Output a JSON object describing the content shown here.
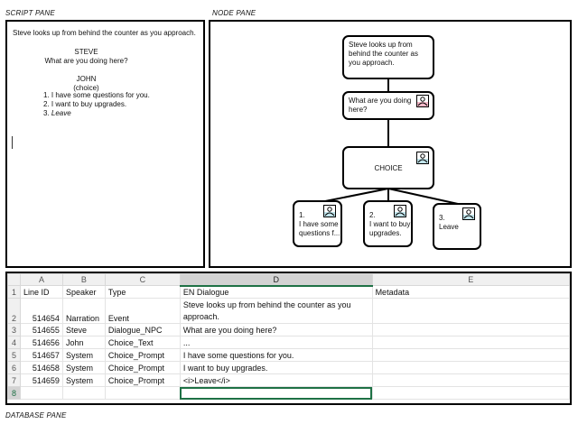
{
  "labels": {
    "script_pane": "SCRIPT PANE",
    "node_pane": "NODE PANE",
    "database_pane": "DATABASE PANE"
  },
  "script": {
    "narration": "Steve looks up from behind the counter as you approach.",
    "speaker1": "STEVE",
    "line1": "What are you doing here?",
    "speaker2": "JOHN",
    "parenthetical": "(choice)",
    "options": [
      "1. I have some questions for you.",
      "2. I want to buy upgrades.",
      "3. "
    ],
    "option3_italic": "Leave"
  },
  "nodes": {
    "event": {
      "text_lines": [
        "Steve looks up from",
        "behind the counter as",
        "you approach."
      ]
    },
    "dialogue": {
      "text_lines": [
        "What are you doing",
        "here?"
      ],
      "icon": "portrait-icon",
      "icon_color": "#f5b8c8"
    },
    "choice": {
      "text": "CHOICE",
      "icon": "portrait-icon",
      "icon_color": "#bfe3ea"
    },
    "options": [
      {
        "text_lines": [
          "1.",
          "I have some",
          "questions f..."
        ],
        "icon": "portrait-icon",
        "icon_color": "#bfe3ea"
      },
      {
        "text_lines": [
          "2.",
          "I want to buy",
          "upgrades."
        ],
        "icon": "portrait-icon",
        "icon_color": "#bfe3ea"
      },
      {
        "text_lines": [
          "3.",
          "Leave"
        ],
        "icon": "portrait-icon",
        "icon_color": "#bfe3ea"
      }
    ]
  },
  "database": {
    "column_letters": [
      "A",
      "B",
      "C",
      "D",
      "E"
    ],
    "selected_column": "D",
    "headers": [
      "Line ID",
      "Speaker",
      "Type",
      "EN Dialogue",
      "Metadata"
    ],
    "rows": [
      [
        "514654",
        "Narration",
        "Event",
        "Steve looks up from behind the counter as you approach.",
        ""
      ],
      [
        "514655",
        "Steve",
        "Dialogue_NPC",
        "What are you doing here?",
        ""
      ],
      [
        "514656",
        "John",
        "Choice_Text",
        "...",
        ""
      ],
      [
        "514657",
        "System",
        "Choice_Prompt",
        "I have some questions for you.",
        ""
      ],
      [
        "514658",
        "System",
        "Choice_Prompt",
        "I want to buy upgrades.",
        ""
      ],
      [
        "514659",
        "System",
        "Choice_Prompt",
        "<i>Leave</i>",
        ""
      ],
      [
        "",
        "",
        "",
        "",
        ""
      ]
    ],
    "row_numbers": [
      "1",
      "2",
      "3",
      "4",
      "5",
      "6",
      "7",
      "8"
    ],
    "selected_cell": "D8"
  }
}
